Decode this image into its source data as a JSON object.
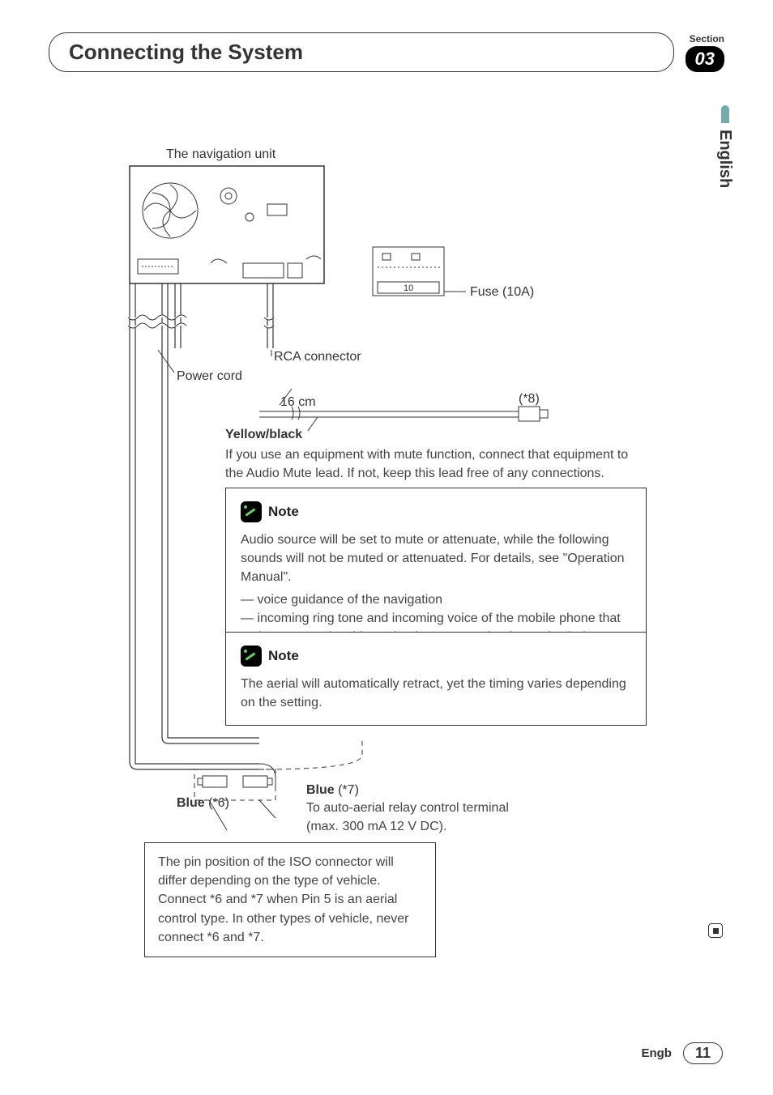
{
  "header": {
    "chapter_title": "Connecting the System",
    "section_label": "Section",
    "section_number": "03"
  },
  "lang_tab": "English",
  "diagram": {
    "nav_unit_label": "The navigation unit",
    "fuse_label": "Fuse (10A)",
    "fuse_value": "10",
    "rca_label": "RCA connector",
    "power_cord_label": "Power cord",
    "length_label": "16 cm",
    "star8": "(*8)",
    "yellow_black_head": "Yellow/black",
    "yellow_black_body": "If you use an equipment with mute function, connect that equipment to the Audio Mute lead. If not, keep this lead free of any connections.",
    "note1_title": "Note",
    "note1_body": "Audio source will be set to mute or attenuate, while the following sounds will not be muted or attenuated. For details, see \"Operation Manual\".",
    "note1_bullet1": "— voice guidance of the navigation",
    "note1_bullet2": "— incoming ring tone and incoming voice of the mobile phone that is connected to this navigation system via Bluetooth wireless technology",
    "note2_title": "Note",
    "note2_body": "The aerial will automatically retract, yet the timing varies depending on the setting.",
    "blue6_label": "Blue",
    "blue6_ref": "(*6)",
    "blue7_label": "Blue",
    "blue7_ref": "(*7)",
    "blue7_desc": "To auto-aerial relay control terminal (max. 300 mA 12 V DC).",
    "iso_note": "The pin position of the ISO connector will differ depending on the type of vehicle. Connect *6 and *7 when Pin 5 is an aerial control type. In other types of vehicle, never connect *6 and *7."
  },
  "footer": {
    "langcode": "Engb",
    "page": "11"
  }
}
